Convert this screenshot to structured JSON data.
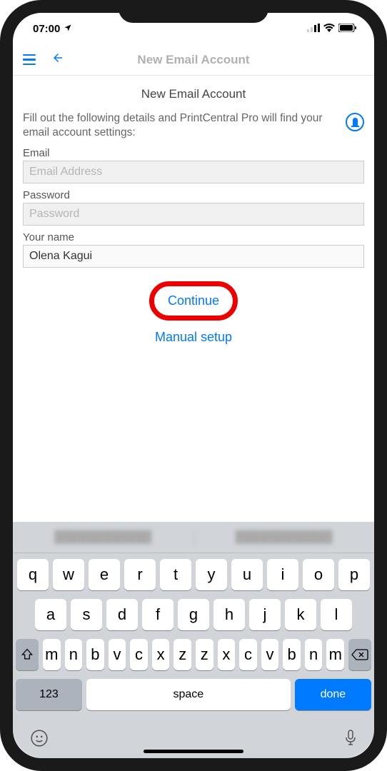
{
  "status": {
    "time": "07:00",
    "loc_icon": "location-arrow"
  },
  "nav": {
    "title": "New Email Account"
  },
  "page": {
    "heading": "New Email Account",
    "description": "Fill out the following details and PrintCentral Pro will find your email account settings:",
    "fields": {
      "email": {
        "label": "Email",
        "placeholder": "Email Address",
        "value": ""
      },
      "password": {
        "label": "Password",
        "placeholder": "Password",
        "value": ""
      },
      "name": {
        "label": "Your name",
        "placeholder": "",
        "value": "Olena Kagui"
      }
    },
    "continue_label": "Continue",
    "manual_label": "Manual setup"
  },
  "keyboard": {
    "suggestions": [
      "████████████",
      "████████████"
    ],
    "row1": [
      "q",
      "w",
      "e",
      "r",
      "t",
      "y",
      "u",
      "i",
      "o",
      "p"
    ],
    "row2": [
      "a",
      "s",
      "d",
      "f",
      "g",
      "h",
      "j",
      "k",
      "l"
    ],
    "row3": [
      "z",
      "x",
      "c",
      "v",
      "b",
      "n",
      "m"
    ],
    "num_label": "123",
    "space_label": "space",
    "done_label": "done"
  }
}
